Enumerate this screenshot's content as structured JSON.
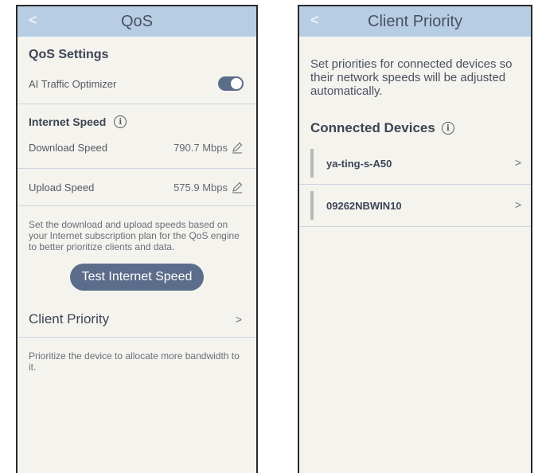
{
  "left": {
    "back_label": "<",
    "title": "QoS",
    "qos_settings_title": "QoS Settings",
    "ai_optimizer_label": "AI Traffic Optimizer",
    "ai_optimizer_on": true,
    "internet_speed_title": "Internet Speed",
    "info_glyph": "i",
    "download_label": "Download Speed",
    "download_value": "790.7 Mbps",
    "upload_label": "Upload Speed",
    "upload_value": "575.9 Mbps",
    "speed_description": "Set the download and upload speeds based on your Internet subscription plan for the QoS engine to better prioritize clients and data.",
    "test_button_label": "Test Internet Speed",
    "client_priority_label": "Client Priority",
    "chevron": ">",
    "client_priority_description": "Prioritize the device to allocate more bandwidth to it."
  },
  "right": {
    "back_label": "<",
    "title": "Client Priority",
    "description": "Set priorities for connected devices so their network speeds will be adjusted automatically.",
    "connected_devices_title": "Connected Devices",
    "info_glyph": "i",
    "chevron": ">",
    "devices": [
      {
        "name": "ya-ting-s-A50"
      },
      {
        "name": "09262NBWIN10"
      }
    ]
  },
  "colors": {
    "header_bg": "#b7cde3",
    "panel_bg": "#f4f3ee",
    "accent": "#5b6d8a"
  }
}
